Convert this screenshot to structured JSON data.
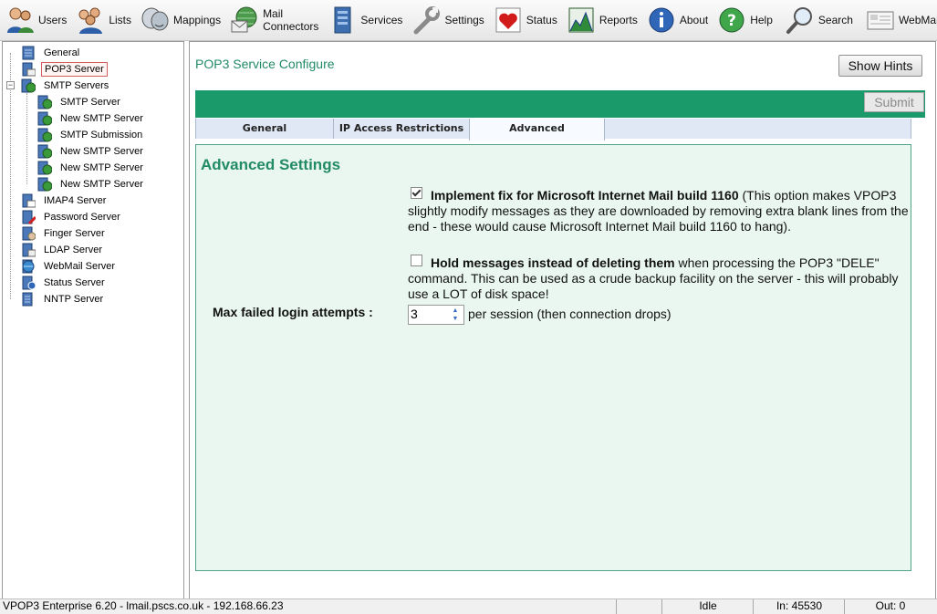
{
  "toolbar": {
    "items": [
      {
        "label": "Users",
        "icon": "users-icon"
      },
      {
        "label": "Lists",
        "icon": "lists-icon"
      },
      {
        "label": "Mappings",
        "icon": "mappings-icon"
      },
      {
        "label": "Mail Connectors",
        "icon": "mail-connectors-icon"
      },
      {
        "label": "Services",
        "icon": "services-icon"
      },
      {
        "label": "Settings",
        "icon": "settings-icon"
      },
      {
        "label": "Status",
        "icon": "status-icon"
      },
      {
        "label": "Reports",
        "icon": "reports-icon"
      },
      {
        "label": "About",
        "icon": "about-icon"
      },
      {
        "label": "Help",
        "icon": "help-icon"
      },
      {
        "label": "Search",
        "icon": "search-icon"
      },
      {
        "label": "WebMail",
        "icon": "webmail-icon"
      }
    ]
  },
  "tree": {
    "items": [
      {
        "label": "General",
        "level": 0,
        "selected": false
      },
      {
        "label": "POP3 Server",
        "level": 0,
        "selected": true
      },
      {
        "label": "SMTP Servers",
        "level": 0,
        "selected": false,
        "expanded": true
      },
      {
        "label": "SMTP Server",
        "level": 1,
        "selected": false
      },
      {
        "label": "New SMTP Server",
        "level": 1,
        "selected": false
      },
      {
        "label": "SMTP Submission",
        "level": 1,
        "selected": false
      },
      {
        "label": "New SMTP Server",
        "level": 1,
        "selected": false
      },
      {
        "label": "New SMTP Server",
        "level": 1,
        "selected": false
      },
      {
        "label": "New SMTP Server",
        "level": 1,
        "selected": false
      },
      {
        "label": "IMAP4 Server",
        "level": 0,
        "selected": false
      },
      {
        "label": "Password Server",
        "level": 0,
        "selected": false
      },
      {
        "label": "Finger Server",
        "level": 0,
        "selected": false
      },
      {
        "label": "LDAP Server",
        "level": 0,
        "selected": false
      },
      {
        "label": "WebMail Server",
        "level": 0,
        "selected": false
      },
      {
        "label": "Status Server",
        "level": 0,
        "selected": false
      },
      {
        "label": "NNTP Server",
        "level": 0,
        "selected": false
      }
    ]
  },
  "main": {
    "title": "POP3 Service Configure",
    "show_hints_label": "Show Hints",
    "submit_label": "Submit",
    "tabs": [
      {
        "label": "General",
        "active": false
      },
      {
        "label": "IP Access Restrictions",
        "active": false
      },
      {
        "label": "Advanced",
        "active": true
      }
    ],
    "panel": {
      "title": "Advanced Settings",
      "options": [
        {
          "checked": true,
          "bold": "Implement fix for Microsoft Internet Mail build 1160",
          "text": " (This option makes VPOP3 slightly modify messages as they are downloaded by removing extra blank lines from the end - these would cause Microsoft Internet Mail build 1160 to hang)."
        },
        {
          "checked": false,
          "bold": "Hold messages instead of deleting them",
          "text": " when processing the POP3 \"DELE\" command. This can be used as a crude backup facility on the server - this will probably use a LOT of disk space!"
        }
      ],
      "max_failed_label": "Max failed login attempts :",
      "max_failed_value": "3",
      "max_failed_suffix": "per session (then connection drops)"
    }
  },
  "statusbar": {
    "info": "VPOP3 Enterprise 6.20 - lmail.pscs.co.uk - 192.168.66.23",
    "blank1": "",
    "blank2": "",
    "state": "Idle",
    "in": "In: 45530",
    "out": "Out: 0"
  }
}
